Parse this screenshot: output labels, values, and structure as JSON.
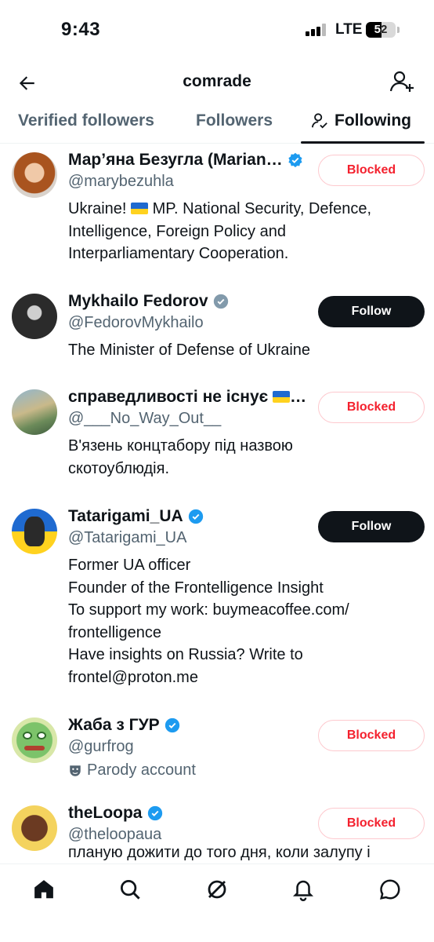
{
  "status_bar": {
    "time": "9:43",
    "network": "LTE",
    "battery": "52",
    "battery_level": 0.52
  },
  "header": {
    "title": "comrade"
  },
  "tabs": [
    {
      "label": "Verified followers",
      "active": false
    },
    {
      "label": "Followers",
      "active": false
    },
    {
      "label": "Following",
      "active": true
    }
  ],
  "users": [
    {
      "name": "Мар’яна Безугла (Marian…",
      "verified": true,
      "handle": "@marybezuhla",
      "bio_lines": [
        "Ukraine! __FLAG__ MP. National Security, Defence,",
        "Intelligence, Foreign Policy and",
        "Interparliamentary Cooperation."
      ],
      "button": "Blocked"
    },
    {
      "name": "Mykhailo Fedorov",
      "verified": true,
      "verified_color": "gray",
      "handle": "@FedorovMykhailo",
      "bio_lines": [
        "The Minister of Defense of Ukraine"
      ],
      "button": "Follow"
    },
    {
      "name": "справедливості не існує __FLAG__…",
      "verified": false,
      "handle": "@___No_Way_Out__",
      "bio_lines": [
        "В'язень концтабору під назвою",
        "скотоублюдія."
      ],
      "button": "Blocked"
    },
    {
      "name": "Tatarigami_UA",
      "verified": true,
      "handle": "@Tatarigami_UA",
      "bio_lines": [
        "Former UA officer",
        "Founder of the Frontelligence Insight",
        "To support my work: buymeacoffee.com/",
        "frontelligence",
        "Have insights on Russia? Write to",
        "frontel@proton.me"
      ],
      "button": "Follow"
    },
    {
      "name": "Жаба з ГУР",
      "verified": true,
      "handle": "@gurfrog",
      "parody": "Parody account",
      "button": "Blocked"
    },
    {
      "name": "theLoopa",
      "verified": true,
      "handle": "@theloopaua",
      "bio_lines": [
        "планую дожити до того дня, коли залупу і"
      ],
      "button": "Blocked"
    }
  ],
  "nav": [
    "home-icon",
    "search-icon",
    "grok-icon",
    "notifications-icon",
    "messages-icon"
  ],
  "colors": {
    "accent": "#1d9bf0",
    "blocked": "#f4212e",
    "text": "#0f1419",
    "muted": "#536471"
  }
}
